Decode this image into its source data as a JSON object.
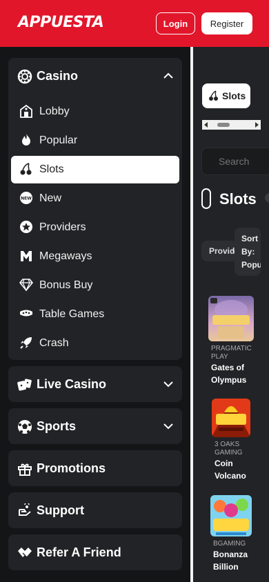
{
  "header": {
    "logo": "APPUESTA",
    "login_label": "Login",
    "register_label": "Register",
    "bg_color": "#e2162b"
  },
  "sidebar": {
    "casino": {
      "label": "Casino",
      "icon": "casino-chip-icon",
      "items": [
        {
          "label": "Lobby",
          "icon": "lobby-building-icon"
        },
        {
          "label": "Popular",
          "icon": "flame-icon"
        },
        {
          "label": "Slots",
          "icon": "cherries-icon",
          "active": true
        },
        {
          "label": "New",
          "icon": "new-badge-icon"
        },
        {
          "label": "Providers",
          "icon": "star-icon"
        },
        {
          "label": "Megaways",
          "icon": "megaways-m-icon"
        },
        {
          "label": "Bonus Buy",
          "icon": "diamond-icon"
        },
        {
          "label": "Table Games",
          "icon": "card-table-icon"
        },
        {
          "label": "Crash",
          "icon": "rocket-icon"
        }
      ]
    },
    "live_casino": {
      "label": "Live Casino",
      "icon": "dice-icon"
    },
    "sports": {
      "label": "Sports",
      "icon": "soccer-ball-icon"
    },
    "promotions": {
      "label": "Promotions",
      "icon": "gift-icon"
    },
    "support": {
      "label": "Support",
      "icon": "support-hand-icon"
    },
    "refer": {
      "label": "Refer A Friend",
      "icon": "handshake-icon"
    }
  },
  "main": {
    "chip_label": "Slots",
    "search_placeholder": "Search",
    "heading": "Slots",
    "providers_label": "Provid",
    "sort_label_1": "Sort",
    "sort_label_2": "By:",
    "sort_label_3": "Popula",
    "games": [
      {
        "provider_1": "PRAGMATIC",
        "provider_2": "PLAY",
        "name_1": "Gates of",
        "name_2": "Olympus"
      },
      {
        "provider_1": "3 OAKS",
        "provider_2": "GAMING",
        "name_1": "Coin",
        "name_2": "Volcano"
      },
      {
        "provider_1": "BGAMING",
        "provider_2": "",
        "name_1": "Bonanza",
        "name_2": "Billion"
      }
    ]
  }
}
